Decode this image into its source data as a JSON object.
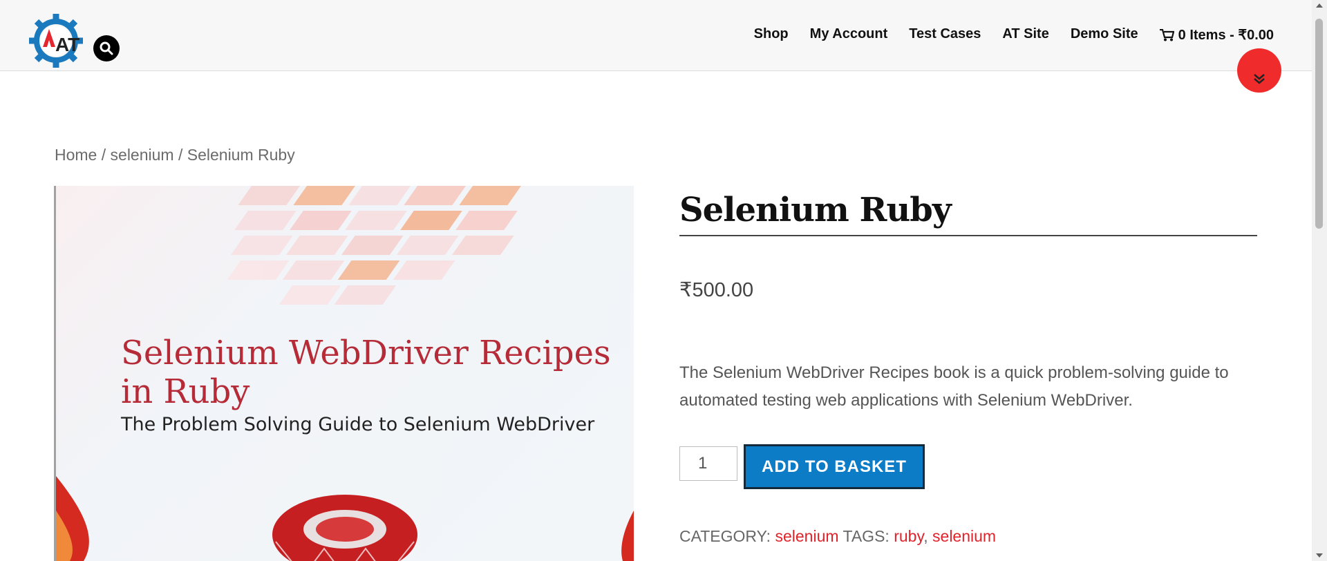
{
  "nav": {
    "items": [
      "Shop",
      "My Account",
      "Test Cases",
      "AT Site",
      "Demo Site"
    ],
    "cart": "0 Items - ₹0.00"
  },
  "logo": {
    "text": "AT"
  },
  "breadcrumb": {
    "home": "Home",
    "category": "selenium",
    "current": "Selenium Ruby"
  },
  "product": {
    "title": "Selenium Ruby",
    "price": "₹500.00",
    "description": "The Selenium WebDriver Recipes book is a quick problem-solving guide to automated testing web applications with Selenium WebDriver.",
    "quantity": "1",
    "add_button": "ADD TO BASKET",
    "category_label": "CATEGORY:",
    "category": "selenium",
    "tags_label": "TAGS:",
    "tags": [
      "ruby",
      "selenium"
    ]
  },
  "image": {
    "title_line1": "Selenium WebDriver Recipes",
    "title_line2": "in Ruby",
    "subtitle": "The Problem Solving Guide to Selenium WebDriver"
  },
  "colors": {
    "accent_red": "#e0232b",
    "button_blue": "#0d7cc7",
    "scroll_button_red": "#ef2b2b"
  },
  "icons": [
    "search-icon",
    "cart-icon",
    "double-chevron-down-icon",
    "gear-logo-icon"
  ]
}
